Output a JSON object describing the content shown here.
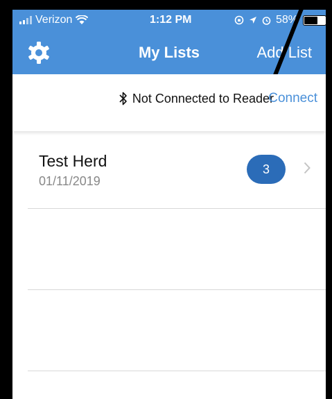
{
  "status_bar": {
    "carrier": "Verizon",
    "time": "1:12 PM",
    "battery": "58%",
    "battery_level": 0.58
  },
  "nav": {
    "title": "My Lists",
    "add_list_label": "Add List"
  },
  "connection": {
    "status_text": "Not Connected to Reader",
    "connect_label": "Connect"
  },
  "lists": [
    {
      "title": "Test Herd",
      "date": "01/11/2019",
      "count": "3"
    }
  ],
  "colors": {
    "header": "#4a90d9",
    "badge": "#2b6cb8",
    "link": "#4a90d9"
  },
  "icons": {
    "settings": "gear-icon",
    "bluetooth": "bluetooth-icon",
    "row_chevron": "chevron-right-icon"
  }
}
